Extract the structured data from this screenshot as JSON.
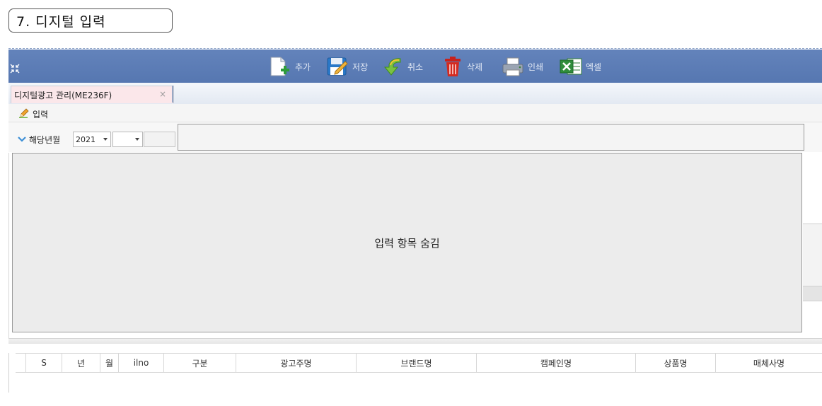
{
  "page": {
    "title": "7. 디지털 입력"
  },
  "toolbar": {
    "buttons": [
      {
        "id": "add",
        "label": "추가",
        "icon": "add-document-icon"
      },
      {
        "id": "save",
        "label": "저장",
        "icon": "save-icon"
      },
      {
        "id": "cancel",
        "label": "취소",
        "icon": "undo-arrow-icon"
      },
      {
        "id": "delete",
        "label": "삭제",
        "icon": "trash-icon"
      },
      {
        "id": "print",
        "label": "인쇄",
        "icon": "printer-icon"
      },
      {
        "id": "excel",
        "label": "엑셀",
        "icon": "excel-icon"
      }
    ],
    "colors": {
      "background": "#5a7bb5"
    }
  },
  "tab": {
    "label": "디지털광고 관리(ME236F)",
    "close": "×"
  },
  "input_section": {
    "label": "입력"
  },
  "filter": {
    "label": "해당년월",
    "year": "2021",
    "month": ""
  },
  "panel": {
    "message": "입력 항목 숨김"
  },
  "grid": {
    "columns": [
      "S",
      "년",
      "월",
      "ilno",
      "구분",
      "광고주명",
      "브랜드명",
      "캠페인명",
      "상품명",
      "매체사명"
    ]
  }
}
